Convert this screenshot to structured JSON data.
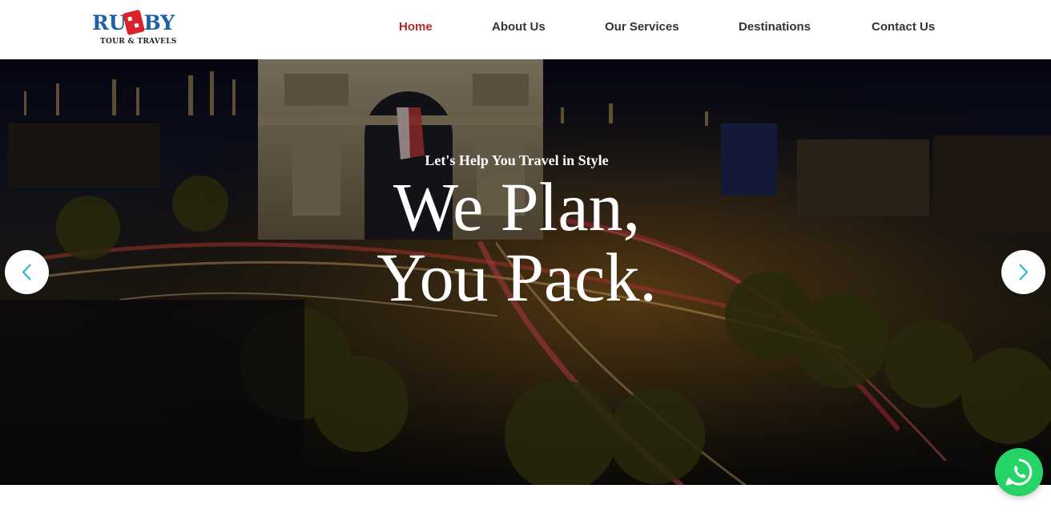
{
  "logo": {
    "word_left": "RU",
    "word_right": "BY",
    "subtitle": "TOUR & TRAVELS",
    "colors": {
      "blue": "#1e5fa8",
      "red": "#d8232a"
    }
  },
  "nav": {
    "items": [
      {
        "label": "Home",
        "active": true
      },
      {
        "label": "About Us",
        "active": false
      },
      {
        "label": "Our Services",
        "active": false
      },
      {
        "label": "Destinations",
        "active": false
      },
      {
        "label": "Contact Us",
        "active": false
      }
    ],
    "active_color": "#b3262b"
  },
  "hero": {
    "eyebrow": "Let's Help You Travel in Style",
    "headline_line1": "We Plan,",
    "headline_line2": "You Pack.",
    "prev_icon": "chevron-left-icon",
    "next_icon": "chevron-right-icon",
    "arrow_color": "#1fb6c9"
  },
  "chat": {
    "icon": "whatsapp-icon",
    "color": "#25d366"
  }
}
